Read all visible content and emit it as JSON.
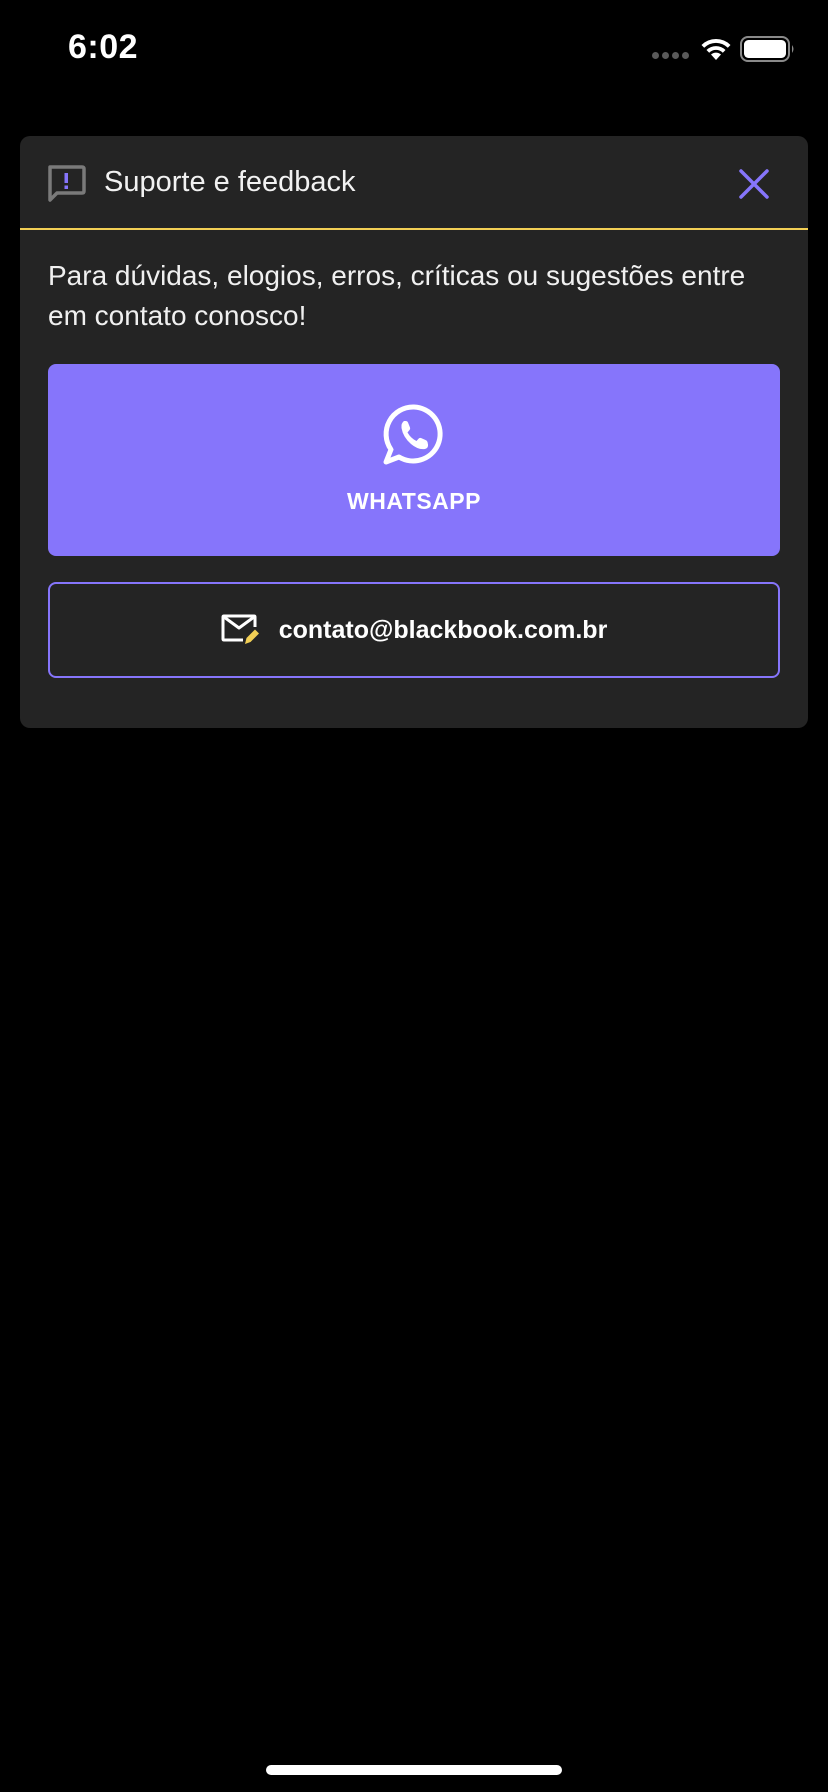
{
  "status_bar": {
    "time": "6:02"
  },
  "dialog": {
    "title": "Suporte e feedback",
    "description": "Para dúvidas, elogios, erros, críticas ou sugestões entre em contato conosco!",
    "whatsapp_label": "WHATSAPP",
    "email_label": "contato@blackbook.com.br"
  },
  "icons": {
    "header": "feedback-icon",
    "close": "close-icon",
    "whatsapp": "whatsapp-icon",
    "email": "email-edit-icon"
  },
  "colors": {
    "background": "#000000",
    "card": "#242424",
    "accent": "#8675fb",
    "divider": "#f2cf55"
  }
}
